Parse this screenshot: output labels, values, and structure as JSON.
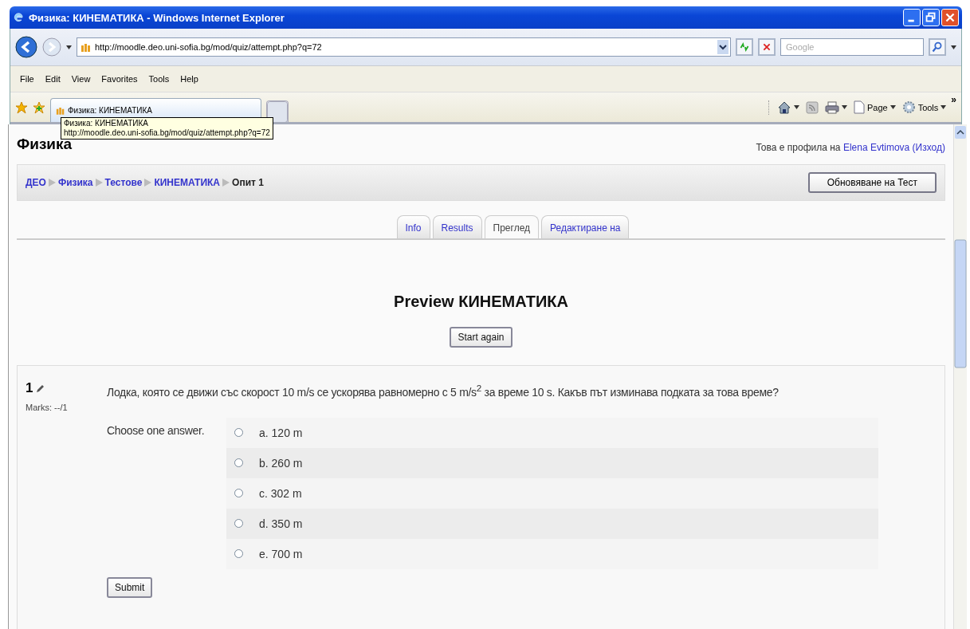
{
  "window": {
    "title": "Физика: КИНЕМАТИКА - Windows Internet Explorer"
  },
  "address_bar": {
    "url": "http://moodle.deo.uni-sofia.bg/mod/quiz/attempt.php?q=72"
  },
  "search": {
    "placeholder": "Google"
  },
  "menu": [
    "File",
    "Edit",
    "View",
    "Favorites",
    "Tools",
    "Help"
  ],
  "browser_tab": {
    "title": "Физика: КИНЕМАТИКА"
  },
  "tooltip": {
    "title": "Физика: КИНЕМАТИКА",
    "url": "http://moodle.deo.uni-sofia.bg/mod/quiz/attempt.php?q=72"
  },
  "command_bar": [
    {
      "kind": "home"
    },
    {
      "kind": "feeds"
    },
    {
      "kind": "print"
    },
    {
      "kind": "page",
      "label": "Page"
    },
    {
      "kind": "tools",
      "label": "Tools"
    }
  ],
  "command_more": "»",
  "page": {
    "site_title": "Физика",
    "login": {
      "prefix": "Това е профила на",
      "user": "Elena Evtimova",
      "logout": "(Изход)"
    },
    "breadcrumb": [
      {
        "label": "ДЕО",
        "link": true
      },
      {
        "label": "Физика",
        "link": true
      },
      {
        "label": "Тестове",
        "link": true
      },
      {
        "label": "КИНЕМАТИКА",
        "link": true
      },
      {
        "label": "Опит 1",
        "link": false
      }
    ],
    "update_button": "Обновяване на Тест",
    "tabs": [
      {
        "label": "Info",
        "selected": false
      },
      {
        "label": "Results",
        "selected": false
      },
      {
        "label": "Преглед",
        "selected": true
      },
      {
        "label": "Редактиране на",
        "selected": false
      }
    ],
    "heading": "Preview КИНЕМАТИКА",
    "start_button": "Start again",
    "question": {
      "number": "1",
      "marks": "Marks: --/1",
      "text": "Лодка, която се движи със скорост 10 m/s се ускорява равномерно с 5 m/s$^{2}$ за време 10 s. Какъв път изминава подката за това време?",
      "prompt": "Choose one answer.",
      "options": [
        {
          "label": "a. 120 m",
          "checked": false
        },
        {
          "label": "b. 260 m",
          "checked": false
        },
        {
          "label": "c. 302 m",
          "checked": false
        },
        {
          "label": "d. 350 m",
          "checked": false
        },
        {
          "label": "e. 700 m",
          "checked": false
        }
      ],
      "submit": "Submit"
    }
  }
}
